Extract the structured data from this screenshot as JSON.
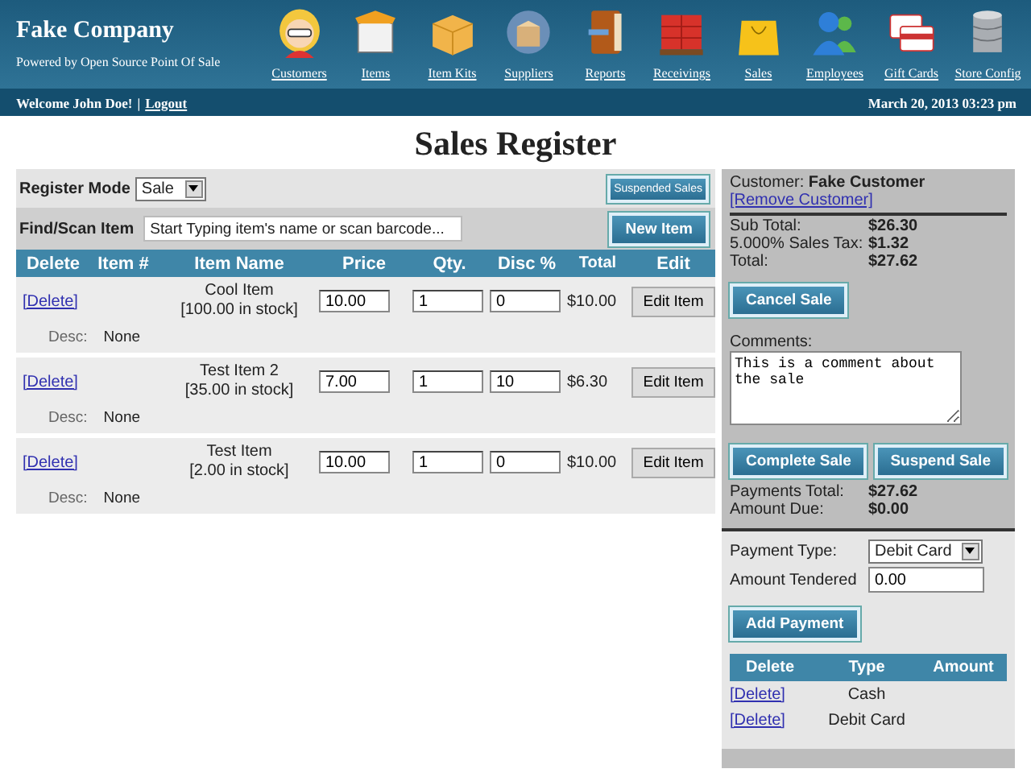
{
  "header": {
    "company": "Fake Company",
    "tagline": "Powered by Open Source Point Of Sale",
    "modules": [
      {
        "label": "Customers",
        "kind": "person"
      },
      {
        "label": "Items",
        "kind": "box"
      },
      {
        "label": "Item Kits",
        "kind": "parcel"
      },
      {
        "label": "Suppliers",
        "kind": "globe"
      },
      {
        "label": "Reports",
        "kind": "book"
      },
      {
        "label": "Receivings",
        "kind": "pallet"
      },
      {
        "label": "Sales",
        "kind": "bag"
      },
      {
        "label": "Employees",
        "kind": "people"
      },
      {
        "label": "Gift Cards",
        "kind": "cards"
      },
      {
        "label": "Store Config",
        "kind": "database"
      }
    ]
  },
  "user_bar": {
    "welcome": "Welcome John Doe!",
    "separator": "|",
    "logout": "Logout",
    "date": "March 20, 2013 03:23 pm"
  },
  "page_title": "Sales Register",
  "register": {
    "mode_label": "Register Mode",
    "mode": "Sale",
    "suspended_button": "Suspended Sales",
    "find_label": "Find/Scan Item",
    "find_placeholder": "Start Typing item's name or scan barcode...",
    "new_item_button": "New Item",
    "columns": [
      "Delete",
      "Item #",
      "Item Name",
      "Price",
      "Qty.",
      "Disc %",
      "Total",
      "Edit"
    ],
    "items": [
      {
        "delete": "[Delete]",
        "name": "Cool Item",
        "stock": "[100.00 in stock]",
        "price": "10.00",
        "qty": "1",
        "disc": "0",
        "total": "$10.00",
        "edit": "Edit Item",
        "desc_label": "Desc:",
        "desc": "None"
      },
      {
        "delete": "[Delete]",
        "name": "Test Item 2",
        "stock": "[35.00 in stock]",
        "price": "7.00",
        "qty": "1",
        "disc": "10",
        "total": "$6.30",
        "edit": "Edit Item",
        "desc_label": "Desc:",
        "desc": "None"
      },
      {
        "delete": "[Delete]",
        "name": "Test Item",
        "stock": "[2.00 in stock]",
        "price": "10.00",
        "qty": "1",
        "disc": "0",
        "total": "$10.00",
        "edit": "Edit Item",
        "desc_label": "Desc:",
        "desc": "None"
      }
    ]
  },
  "summary": {
    "customer_label": "Customer:",
    "customer": "Fake Customer",
    "remove_customer": "[Remove Customer]",
    "totals": [
      {
        "label": "Sub Total:",
        "value": "$26.30"
      },
      {
        "label": "5.000% Sales Tax:",
        "value": "$1.32"
      },
      {
        "label": "Total:",
        "value": "$27.62"
      }
    ],
    "cancel_button": "Cancel Sale",
    "comments_label": "Comments:",
    "comments": "This is a comment about the sale",
    "complete_button": "Complete Sale",
    "suspend_button": "Suspend Sale",
    "payment_totals": [
      {
        "label": "Payments Total:",
        "value": "$27.62"
      },
      {
        "label": "Amount Due:",
        "value": "$0.00"
      }
    ],
    "payment_type_label": "Payment Type:",
    "payment_type": "Debit Card",
    "amount_tendered_label": "Amount Tendered",
    "amount_tendered": "0.00",
    "add_payment_button": "Add Payment",
    "payment_columns": [
      "Delete",
      "Type",
      "Amount"
    ],
    "payments": [
      {
        "delete": "[Delete]",
        "type": "Cash"
      },
      {
        "delete": "[Delete]",
        "type": "Debit Card"
      }
    ]
  }
}
